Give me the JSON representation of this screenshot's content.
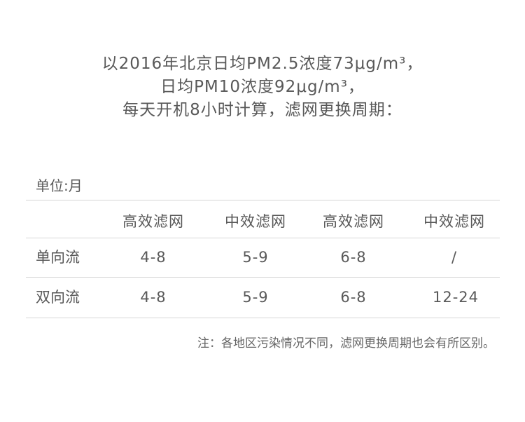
{
  "intro": {
    "line1": "以2016年北京日均PM2.5浓度73μg/m³，",
    "line2": "日均PM10浓度92μg/m³，",
    "line3": "每天开机8小时计算，滤网更换周期："
  },
  "unit_label": "单位:月",
  "table": {
    "headers": [
      "高效滤网",
      "中效滤网",
      "高效滤网",
      "中效滤网"
    ],
    "rows": [
      {
        "label": "单向流",
        "cells": [
          "4-8",
          "5-9",
          "6-8",
          "/"
        ]
      },
      {
        "label": "双向流",
        "cells": [
          "4-8",
          "5-9",
          "6-8",
          "12-24"
        ]
      }
    ]
  },
  "note": "注：各地区污染情况不同，滤网更换周期也会有所区别。"
}
